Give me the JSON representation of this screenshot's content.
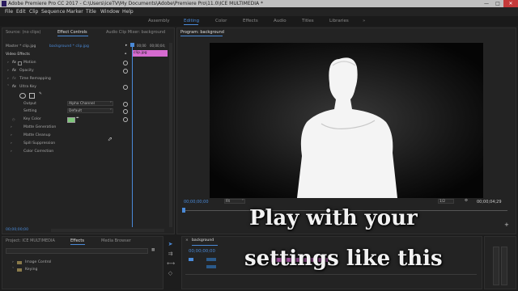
{
  "window": {
    "title": "Adobe Premiere Pro CC 2017 - C:\\Users\\iceTV\\My Documents\\Adobe\\Premiere Pro\\11.0\\ICE MULTIMEDIA *"
  },
  "menu": [
    "File",
    "Edit",
    "Clip",
    "Sequence",
    "Marker",
    "Title",
    "Window",
    "Help"
  ],
  "workspaces": [
    "Assembly",
    "Editing",
    "Color",
    "Effects",
    "Audio",
    "Titles",
    "Libraries"
  ],
  "active_workspace": "Editing",
  "source_panel": {
    "tabs": [
      "Source: (no clips)",
      "Effect Controls",
      "Audio Clip Mixer: background"
    ],
    "master_label": "Master * clip.jpg",
    "seq_label": "background * clip.jpg",
    "ruler_start": "00;00",
    "ruler_end": "00;00;04;",
    "clip_name": "clip.jpg",
    "video_effects": "Video Effects",
    "motion": "Motion",
    "opacity": "Opacity",
    "time_remapping": "Time Remapping",
    "ultra_key": "Ultra Key",
    "output_label": "Output",
    "output_value": "Alpha Channel",
    "setting_label": "Setting",
    "setting_value": "Default",
    "key_color_label": "Key Color",
    "key_color": "#7ec77a",
    "matte_generation": "Matte Generation",
    "matte_cleanup": "Matte Cleanup",
    "spill_suppression": "Spill Suppression",
    "color_correction": "Color Correction",
    "timecode": "00;00;00;00"
  },
  "program": {
    "title": "Program: background",
    "timecode_left": "00;00;00;00",
    "fit": "Fit",
    "scale": "1/2",
    "timecode_right": "00;00;04;29"
  },
  "project": {
    "tabs": [
      "Project: ICE MULTIMEDIA",
      "Effects",
      "Media Browser"
    ],
    "items": [
      "Image Control",
      "Keying"
    ]
  },
  "timeline": {
    "sequence_name": "background",
    "timecode": "00;00;00;00"
  },
  "overlay": {
    "line1": "Play with your",
    "line2": "settings like this"
  },
  "colors": {
    "accent": "#4a8ad8",
    "clip_pink": "#d66bd0"
  }
}
